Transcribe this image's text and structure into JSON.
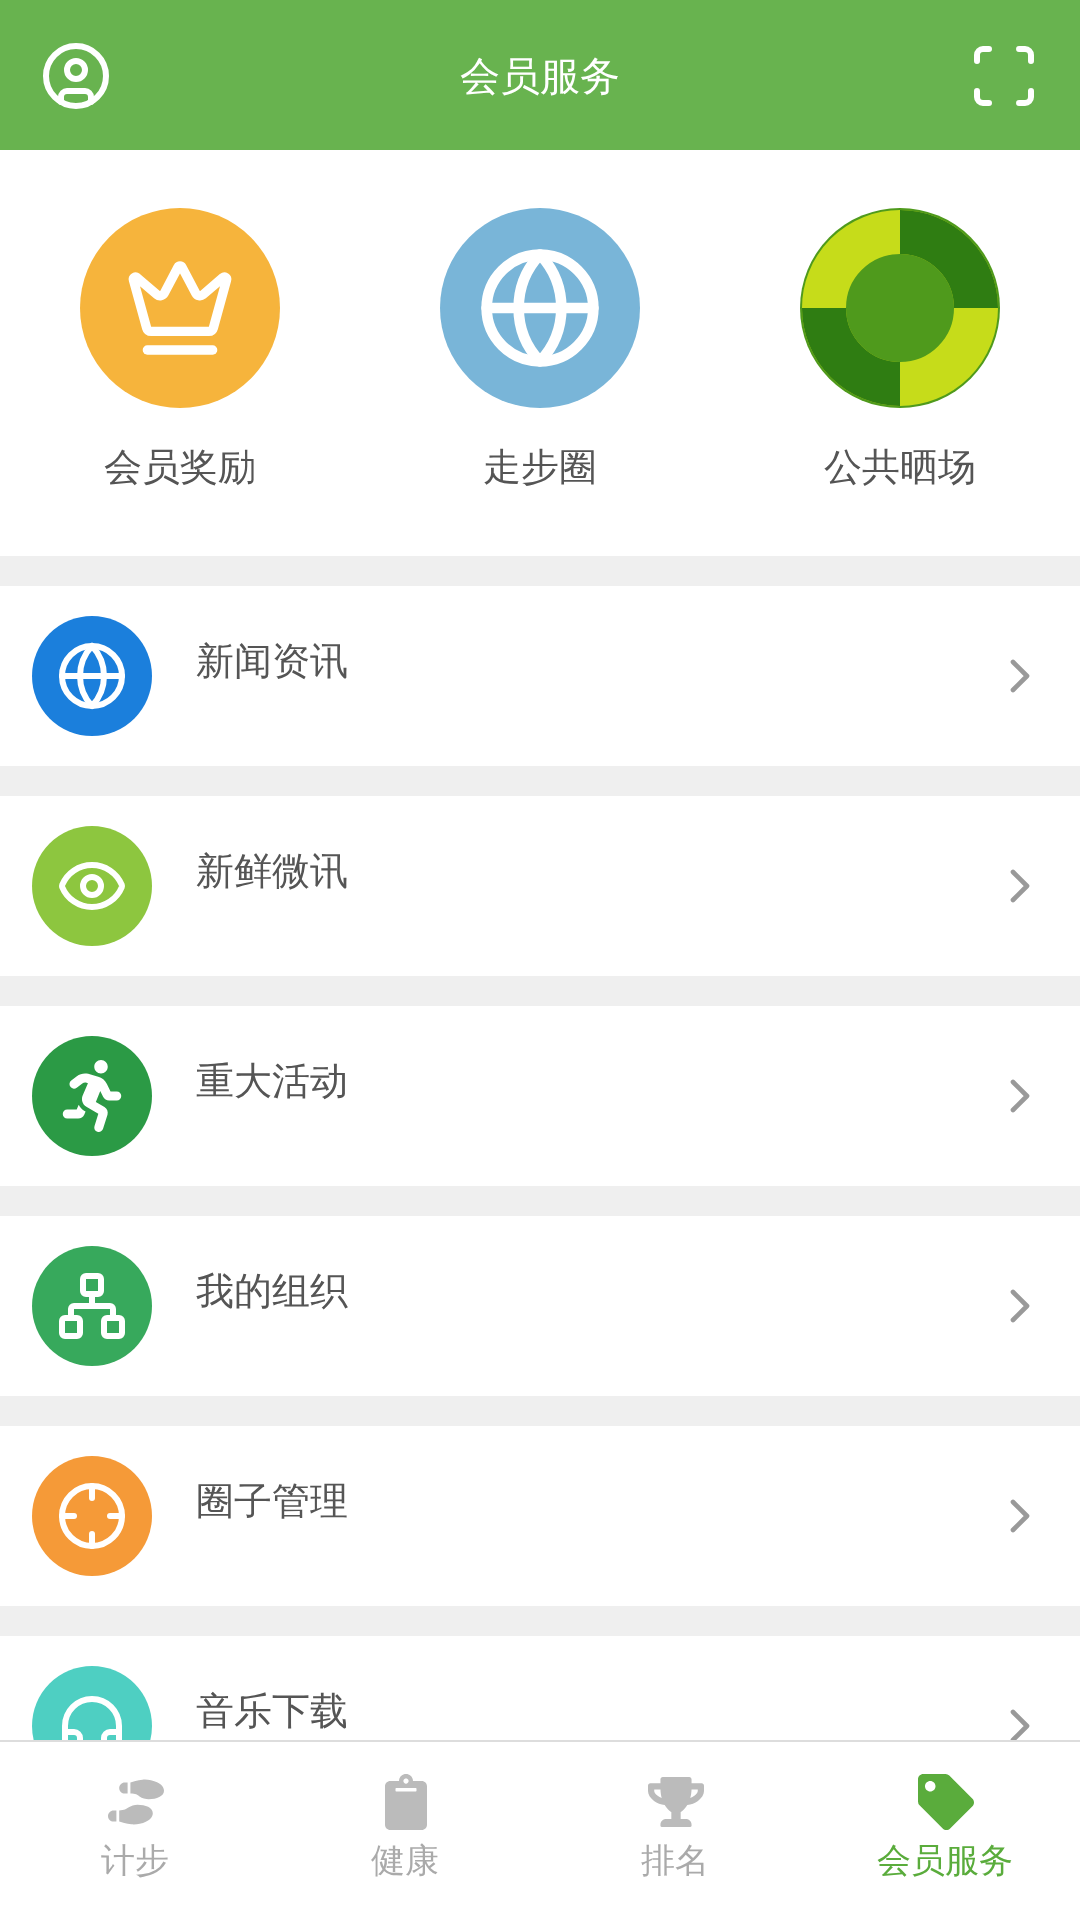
{
  "header": {
    "title": "会员服务"
  },
  "features": [
    {
      "label": "会员奖励",
      "kind": "crown",
      "color": "#f6b43c"
    },
    {
      "label": "走步圈",
      "kind": "globe",
      "color": "#79b5d8"
    },
    {
      "label": "公共晒场",
      "kind": "ring",
      "color": "#4f9a1c"
    }
  ],
  "menu": [
    {
      "label": "新闻资讯",
      "kind": "globe",
      "color": "#1b7fdc"
    },
    {
      "label": "新鲜微讯",
      "kind": "eye",
      "color": "#8dc63f"
    },
    {
      "label": "重大活动",
      "kind": "run",
      "color": "#2b9a45"
    },
    {
      "label": "我的组织",
      "kind": "org",
      "color": "#37a95c"
    },
    {
      "label": "圈子管理",
      "kind": "target",
      "color": "#f59a38"
    },
    {
      "label": "音乐下载",
      "kind": "music",
      "color": "#4ecfc2"
    }
  ],
  "tabs": [
    {
      "label": "计步",
      "kind": "steps",
      "selected": false
    },
    {
      "label": "健康",
      "kind": "health",
      "selected": false
    },
    {
      "label": "排名",
      "kind": "rank",
      "selected": false
    },
    {
      "label": "会员服务",
      "kind": "member",
      "selected": true
    }
  ]
}
